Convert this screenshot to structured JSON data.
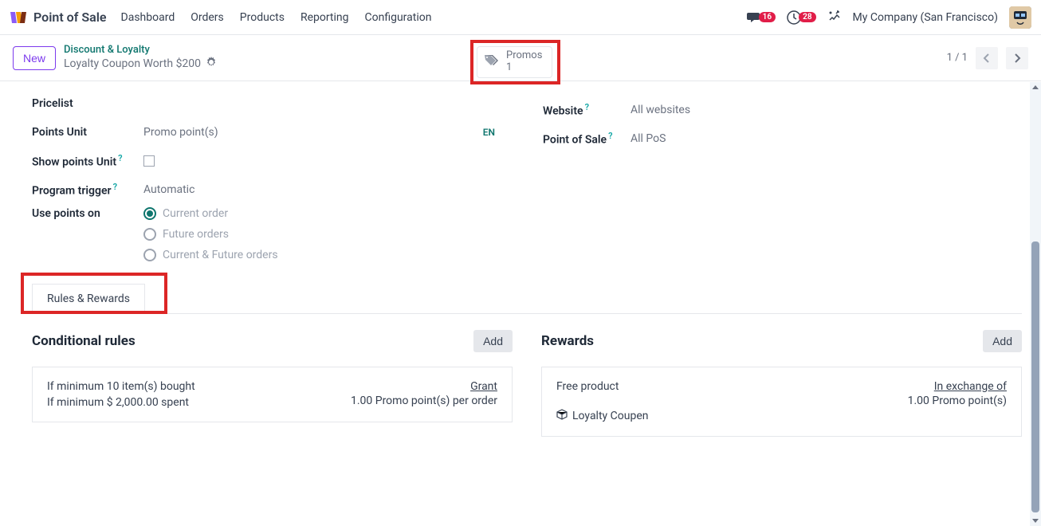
{
  "nav": {
    "app_title": "Point of Sale",
    "items": [
      "Dashboard",
      "Orders",
      "Products",
      "Reporting",
      "Configuration"
    ],
    "messages_badge": "16",
    "activities_badge": "28",
    "company": "My Company (San Francisco)"
  },
  "control": {
    "new_label": "New",
    "breadcrumb_top": "Discount & Loyalty",
    "breadcrumb_bottom": "Loyalty Coupon Worth $200",
    "promos_label": "Promos",
    "promos_count": "1",
    "pager": "1 / 1"
  },
  "form": {
    "left": {
      "pricelist_label": "Pricelist",
      "points_unit_label": "Points Unit",
      "points_unit_value": "Promo point(s)",
      "show_points_label": "Show points Unit",
      "program_trigger_label": "Program trigger",
      "program_trigger_value": "Automatic",
      "use_points_label": "Use points on",
      "radio_options": [
        "Current order",
        "Future orders",
        "Current & Future orders"
      ],
      "selected_index": 0,
      "lang_badge": "EN"
    },
    "right": {
      "website_label": "Website",
      "website_value": "All websites",
      "pos_label": "Point of Sale",
      "pos_value": "All PoS"
    }
  },
  "tabs": {
    "active": "Rules & Rewards"
  },
  "rules": {
    "title": "Conditional rules",
    "add_label": "Add",
    "card": {
      "line1": "If minimum 10 item(s) bought",
      "line2": "If minimum $ 2,000.00 spent",
      "grant_label": "Grant",
      "grant_value": "1.00 Promo point(s) per order"
    }
  },
  "rewards": {
    "title": "Rewards",
    "add_label": "Add",
    "card": {
      "line1": "Free product",
      "product_name": "Loyalty Coupen",
      "exchange_label": "In exchange of",
      "exchange_value": "1.00 Promo point(s)"
    }
  }
}
